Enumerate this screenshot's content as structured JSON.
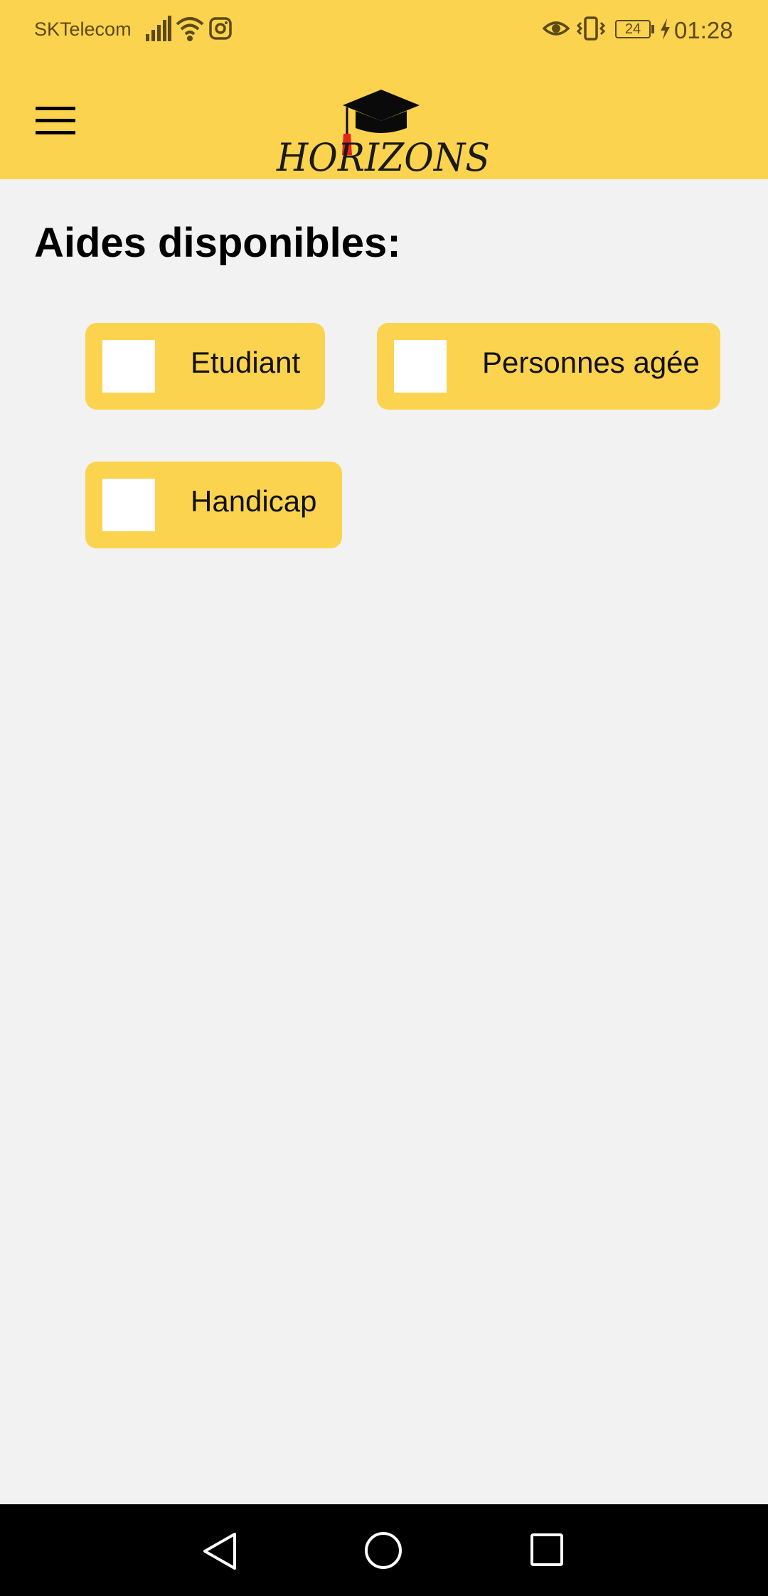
{
  "status_bar": {
    "carrier": "SKTelecom",
    "battery": "24",
    "time": "01:28",
    "icons": [
      "signal-icon",
      "wifi-icon",
      "instagram-icon",
      "eye-icon",
      "vibrate-icon",
      "battery-icon",
      "charging-icon"
    ]
  },
  "header": {
    "logo_text": "HORIZONS",
    "menu_icon": "hamburger-menu-icon"
  },
  "page": {
    "title": "Aides disponibles:"
  },
  "options": [
    {
      "label": "Etudiant",
      "checked": false
    },
    {
      "label": "Personnes agée",
      "checked": false
    },
    {
      "label": "Handicap",
      "checked": false
    }
  ],
  "nav_bar": {
    "buttons": [
      "back-icon",
      "home-icon",
      "recents-icon"
    ]
  },
  "colors": {
    "accent": "#fcd34f",
    "background": "#f2f2f2",
    "nav": "#000000",
    "tassel": "#e8241c"
  }
}
